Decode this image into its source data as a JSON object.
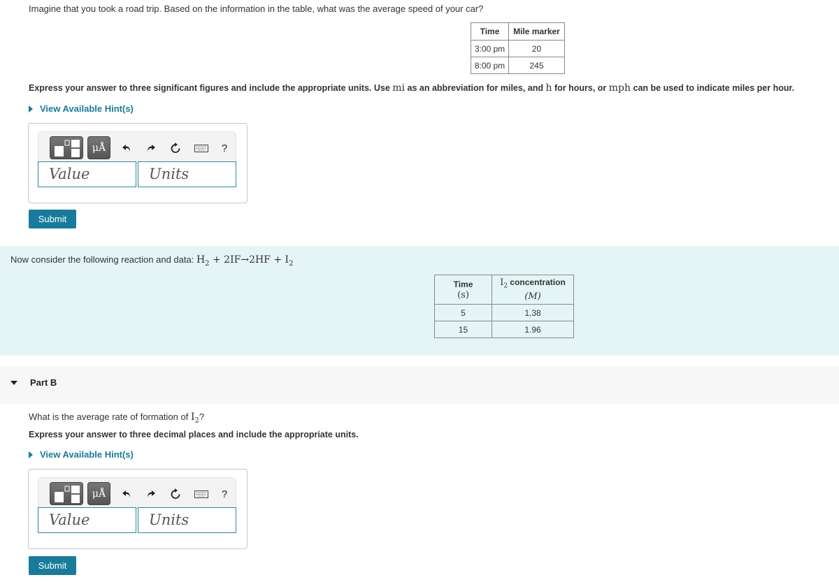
{
  "part_a": {
    "question": "Imagine that you took a road trip. Based on the information in the table, what was the average speed of your car?",
    "table": {
      "headers": [
        "Time",
        "Mile marker"
      ],
      "rows": [
        [
          "3:00 pm",
          "20"
        ],
        [
          "8:00 pm",
          "245"
        ]
      ]
    },
    "instruction": {
      "part1": "Express your answer to three significant figures and include the appropriate units. Use ",
      "mi": "mi",
      "part2": " as an abbreviation for miles, and ",
      "h": "h",
      "part3": " for hours, or ",
      "mph": "mph",
      "part4": " can be used to indicate miles per hour."
    },
    "hint_link": "View Available Hint(s)",
    "answer": {
      "value_placeholder": "Value",
      "units_placeholder": "Units",
      "toolbar": {
        "templates": "templates-icon",
        "units": "μÅ",
        "help": "?"
      }
    },
    "submit_label": "Submit"
  },
  "reaction_intro": {
    "text": "Now consider the following reaction and data: ",
    "equation": {
      "h2": "H",
      "h2_sub": "2",
      "plus1": " + ",
      "reactant2": "2IF",
      "arrow": "→",
      "product1": "2HF",
      "plus2": " + ",
      "i2": "I",
      "i2_sub": "2"
    },
    "table": {
      "header_time": "Time",
      "header_time_unit": "(s)",
      "header_conc_prefix": "I",
      "header_conc_sub": "2",
      "header_conc": " concentration",
      "header_conc_unit": "(M)",
      "rows": [
        [
          "5",
          "1.38"
        ],
        [
          "15",
          "1.96"
        ]
      ]
    }
  },
  "part_b": {
    "title": "Part B",
    "question_prefix": "What is the average rate of formation of ",
    "question_species": "I",
    "question_species_sub": "2",
    "question_suffix": "?",
    "instruction": "Express your answer to three decimal places and include the appropriate units.",
    "hint_link": "View Available Hint(s)",
    "answer": {
      "value_placeholder": "Value",
      "units_placeholder": "Units",
      "toolbar": {
        "units": "μÅ",
        "help": "?"
      }
    },
    "submit_label": "Submit"
  },
  "colors": {
    "accent": "#177c9b",
    "info_band": "#e5f5f6",
    "part_header": "#f7f7f7"
  }
}
